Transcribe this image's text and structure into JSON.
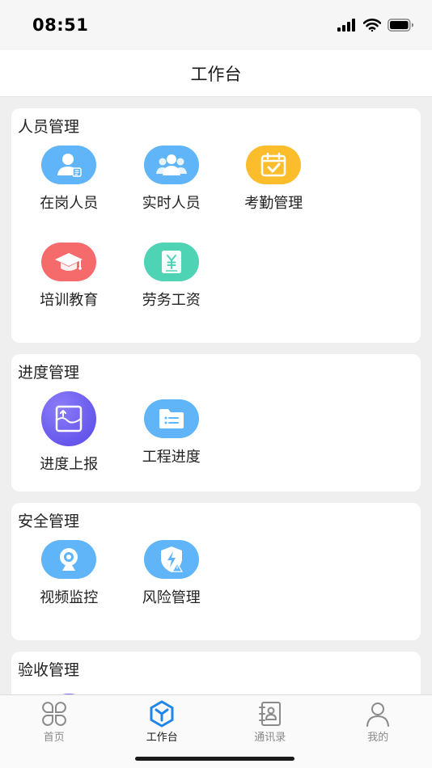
{
  "status": {
    "time": "08:51"
  },
  "header": {
    "title": "工作台"
  },
  "sections": [
    {
      "title": "人员管理",
      "items": [
        {
          "label": "在岗人员",
          "icon": "user-card-icon",
          "color": "#5fb5f7"
        },
        {
          "label": "实时人员",
          "icon": "user-group-icon",
          "color": "#5fb5f7"
        },
        {
          "label": "考勤管理",
          "icon": "calendar-check-icon",
          "color": "#fbbd2c"
        },
        {
          "label": "培训教育",
          "icon": "graduation-cap-icon",
          "color": "#f56b6b"
        },
        {
          "label": "劳务工资",
          "icon": "yuan-document-icon",
          "color": "#4ed3b4"
        }
      ]
    },
    {
      "title": "进度管理",
      "items": [
        {
          "label": "进度上报",
          "icon": "upload-chart-icon",
          "color": "#6a5cf0"
        },
        {
          "label": "工程进度",
          "icon": "folder-list-icon",
          "color": "#5fb5f7"
        }
      ]
    },
    {
      "title": "安全管理",
      "items": [
        {
          "label": "视频监控",
          "icon": "webcam-icon",
          "color": "#5fb5f7"
        },
        {
          "label": "风险管理",
          "icon": "shield-warning-icon",
          "color": "#5fb5f7"
        }
      ]
    },
    {
      "title": "验收管理"
    }
  ],
  "tabs": [
    {
      "label": "首页",
      "icon": "home-clover-icon",
      "active": false
    },
    {
      "label": "工作台",
      "icon": "workbench-cube-icon",
      "active": true,
      "color": "#1f86e8"
    },
    {
      "label": "通讯录",
      "icon": "contacts-book-icon",
      "active": false
    },
    {
      "label": "我的",
      "icon": "profile-icon",
      "active": false
    }
  ]
}
